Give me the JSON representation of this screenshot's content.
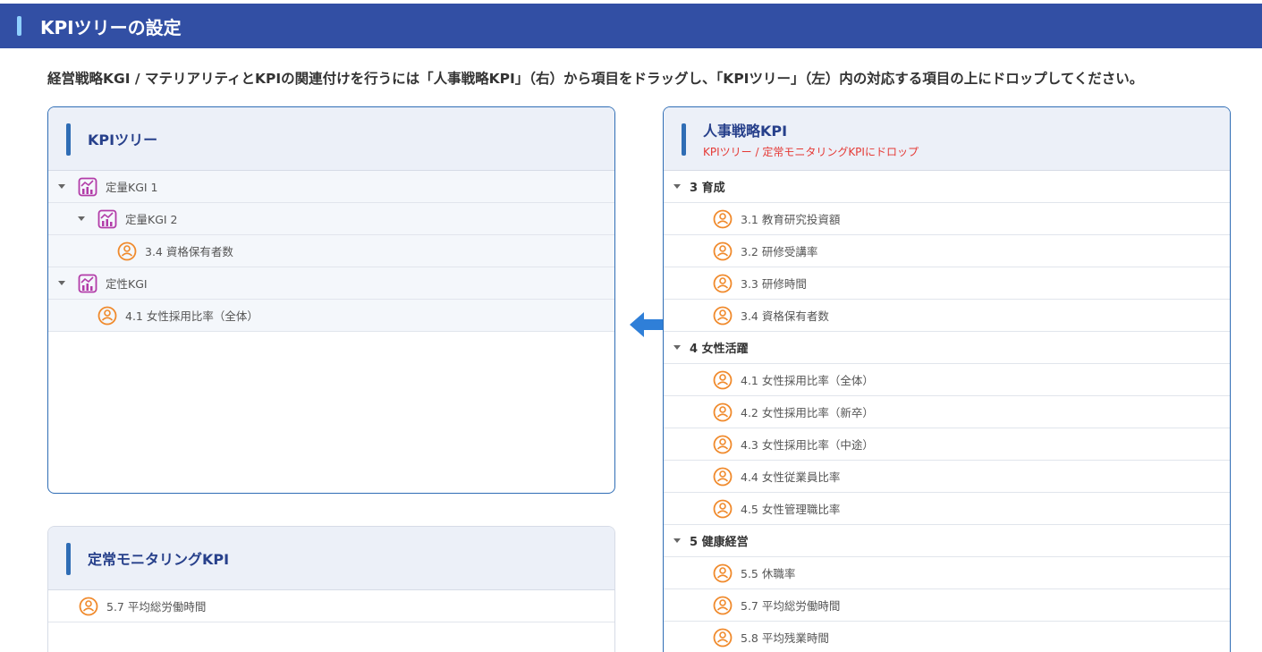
{
  "header": {
    "title": "KPIツリーの設定"
  },
  "instruction": "経営戦略KGI / マテリアリティとKPIの関連付けを行うには「人事戦略KPI」（右）から項目をドラッグし、「KPIツリー」（左）内の対応する項目の上にドロップしてください。",
  "kpi_tree": {
    "title": "KPIツリー",
    "rows": [
      {
        "label": "定量KGI 1",
        "type": "kgi"
      },
      {
        "label": "定量KGI 2",
        "type": "kgi"
      },
      {
        "label": "3.4 資格保有者数",
        "type": "kpi"
      },
      {
        "label": "定性KGI",
        "type": "kgi"
      },
      {
        "label": "4.1 女性採用比率（全体）",
        "type": "kpi"
      }
    ]
  },
  "monitoring": {
    "title": "定常モニタリングKPI",
    "rows": [
      {
        "label": "5.7 平均総労働時間",
        "type": "kpi"
      }
    ]
  },
  "hr_kpi": {
    "title": "人事戦略KPI",
    "subtitle": "KPIツリー / 定常モニタリングKPIにドロップ",
    "groups": [
      {
        "label": "3 育成",
        "items": [
          "3.1 教育研究投資額",
          "3.2 研修受講率",
          "3.3 研修時間",
          "3.4 資格保有者数"
        ]
      },
      {
        "label": "4 女性活躍",
        "items": [
          "4.1 女性採用比率（全体）",
          "4.2 女性採用比率（新卒）",
          "4.3 女性採用比率（中途）",
          "4.4 女性従業員比率",
          "4.5 女性管理職比率"
        ]
      },
      {
        "label": "5 健康経営",
        "items": [
          "5.5 休職率",
          "5.7 平均総労働時間",
          "5.8 平均残業時間"
        ]
      }
    ]
  },
  "icons": {
    "kgi": "kgi-chart-icon",
    "kpi": "kpi-people-icon",
    "arrow": "arrow-left-icon"
  },
  "colors": {
    "header": "#324fa4",
    "accent": "#2f6db5",
    "kgi_icon": "#b23ca8",
    "kpi_icon": "#f08a2c",
    "subtitle": "#e53935"
  }
}
